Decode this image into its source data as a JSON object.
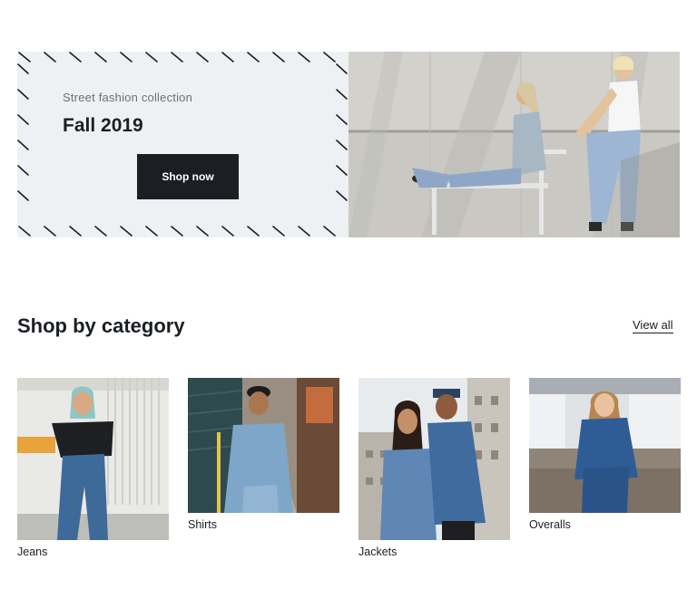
{
  "hero": {
    "eyebrow": "Street fashion collection",
    "title": "Fall 2019",
    "cta_label": "Shop now"
  },
  "categories_section": {
    "title": "Shop by category",
    "view_all_label": "View all",
    "items": [
      {
        "label": "Jeans"
      },
      {
        "label": "Shirts"
      },
      {
        "label": "Jackets"
      },
      {
        "label": "Overalls"
      }
    ]
  },
  "colors": {
    "text": "#1b1f23",
    "promo_bg": "#eef1f3",
    "muted": "#6b7075",
    "button_bg": "#1b1f23",
    "button_text": "#ffffff"
  }
}
